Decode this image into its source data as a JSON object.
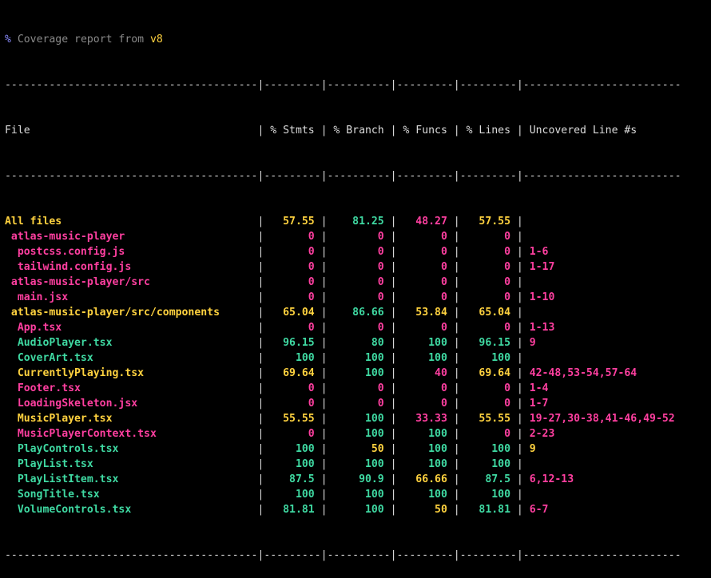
{
  "header": {
    "percent": "%",
    "text": "Coverage report from",
    "version": "v8"
  },
  "colors": {
    "high": "#3fd9a2",
    "medium": "#ffd23f",
    "low": "#ff3fa0",
    "neutral": "#dcdcdc"
  },
  "table": {
    "separator": "----------------------------------------|---------|----------|---------|---------|-------------------------",
    "columns": [
      "File",
      "% Stmts",
      "% Branch",
      "% Funcs",
      "% Lines",
      "Uncovered Line #s"
    ],
    "rows": [
      {
        "file": "All files",
        "indent": 0,
        "stmts": "57.55",
        "branch": "81.25",
        "funcs": "48.27",
        "lines": "57.55",
        "uncovered": "",
        "c": {
          "file": "medium",
          "stmts": "medium",
          "branch": "high",
          "funcs": "low",
          "lines": "medium",
          "uncovered": "low"
        }
      },
      {
        "file": "atlas-music-player",
        "indent": 1,
        "stmts": "0",
        "branch": "0",
        "funcs": "0",
        "lines": "0",
        "uncovered": "",
        "c": {
          "file": "low",
          "stmts": "low",
          "branch": "low",
          "funcs": "low",
          "lines": "low",
          "uncovered": "low"
        }
      },
      {
        "file": "postcss.config.js",
        "indent": 2,
        "stmts": "0",
        "branch": "0",
        "funcs": "0",
        "lines": "0",
        "uncovered": "1-6",
        "c": {
          "file": "low",
          "stmts": "low",
          "branch": "low",
          "funcs": "low",
          "lines": "low",
          "uncovered": "low"
        }
      },
      {
        "file": "tailwind.config.js",
        "indent": 2,
        "stmts": "0",
        "branch": "0",
        "funcs": "0",
        "lines": "0",
        "uncovered": "1-17",
        "c": {
          "file": "low",
          "stmts": "low",
          "branch": "low",
          "funcs": "low",
          "lines": "low",
          "uncovered": "low"
        }
      },
      {
        "file": "atlas-music-player/src",
        "indent": 1,
        "stmts": "0",
        "branch": "0",
        "funcs": "0",
        "lines": "0",
        "uncovered": "",
        "c": {
          "file": "low",
          "stmts": "low",
          "branch": "low",
          "funcs": "low",
          "lines": "low",
          "uncovered": "low"
        }
      },
      {
        "file": "main.jsx",
        "indent": 2,
        "stmts": "0",
        "branch": "0",
        "funcs": "0",
        "lines": "0",
        "uncovered": "1-10",
        "c": {
          "file": "low",
          "stmts": "low",
          "branch": "low",
          "funcs": "low",
          "lines": "low",
          "uncovered": "low"
        }
      },
      {
        "file": "atlas-music-player/src/components",
        "indent": 1,
        "stmts": "65.04",
        "branch": "86.66",
        "funcs": "53.84",
        "lines": "65.04",
        "uncovered": "",
        "c": {
          "file": "medium",
          "stmts": "medium",
          "branch": "high",
          "funcs": "medium",
          "lines": "medium",
          "uncovered": "low"
        }
      },
      {
        "file": "App.tsx",
        "indent": 2,
        "stmts": "0",
        "branch": "0",
        "funcs": "0",
        "lines": "0",
        "uncovered": "1-13",
        "c": {
          "file": "low",
          "stmts": "low",
          "branch": "low",
          "funcs": "low",
          "lines": "low",
          "uncovered": "low"
        }
      },
      {
        "file": "AudioPlayer.tsx",
        "indent": 2,
        "stmts": "96.15",
        "branch": "80",
        "funcs": "100",
        "lines": "96.15",
        "uncovered": "9",
        "c": {
          "file": "high",
          "stmts": "high",
          "branch": "high",
          "funcs": "high",
          "lines": "high",
          "uncovered": "low"
        }
      },
      {
        "file": "CoverArt.tsx",
        "indent": 2,
        "stmts": "100",
        "branch": "100",
        "funcs": "100",
        "lines": "100",
        "uncovered": "",
        "c": {
          "file": "high",
          "stmts": "high",
          "branch": "high",
          "funcs": "high",
          "lines": "high",
          "uncovered": "low"
        }
      },
      {
        "file": "CurrentlyPlaying.tsx",
        "indent": 2,
        "stmts": "69.64",
        "branch": "100",
        "funcs": "40",
        "lines": "69.64",
        "uncovered": "42-48,53-54,57-64",
        "c": {
          "file": "medium",
          "stmts": "medium",
          "branch": "high",
          "funcs": "low",
          "lines": "medium",
          "uncovered": "low"
        }
      },
      {
        "file": "Footer.tsx",
        "indent": 2,
        "stmts": "0",
        "branch": "0",
        "funcs": "0",
        "lines": "0",
        "uncovered": "1-4",
        "c": {
          "file": "low",
          "stmts": "low",
          "branch": "low",
          "funcs": "low",
          "lines": "low",
          "uncovered": "low"
        }
      },
      {
        "file": "LoadingSkeleton.jsx",
        "indent": 2,
        "stmts": "0",
        "branch": "0",
        "funcs": "0",
        "lines": "0",
        "uncovered": "1-7",
        "c": {
          "file": "low",
          "stmts": "low",
          "branch": "low",
          "funcs": "low",
          "lines": "low",
          "uncovered": "low"
        }
      },
      {
        "file": "MusicPlayer.tsx",
        "indent": 2,
        "stmts": "55.55",
        "branch": "100",
        "funcs": "33.33",
        "lines": "55.55",
        "uncovered": "19-27,30-38,41-46,49-52",
        "c": {
          "file": "medium",
          "stmts": "medium",
          "branch": "high",
          "funcs": "low",
          "lines": "medium",
          "uncovered": "low"
        }
      },
      {
        "file": "MusicPlayerContext.tsx",
        "indent": 2,
        "stmts": "0",
        "branch": "100",
        "funcs": "100",
        "lines": "0",
        "uncovered": "2-23",
        "c": {
          "file": "low",
          "stmts": "low",
          "branch": "high",
          "funcs": "high",
          "lines": "low",
          "uncovered": "low"
        }
      },
      {
        "file": "PlayControls.tsx",
        "indent": 2,
        "stmts": "100",
        "branch": "50",
        "funcs": "100",
        "lines": "100",
        "uncovered": "9",
        "c": {
          "file": "high",
          "stmts": "high",
          "branch": "medium",
          "funcs": "high",
          "lines": "high",
          "uncovered": "medium"
        }
      },
      {
        "file": "PlayList.tsx",
        "indent": 2,
        "stmts": "100",
        "branch": "100",
        "funcs": "100",
        "lines": "100",
        "uncovered": "",
        "c": {
          "file": "high",
          "stmts": "high",
          "branch": "high",
          "funcs": "high",
          "lines": "high",
          "uncovered": "low"
        }
      },
      {
        "file": "PlayListItem.tsx",
        "indent": 2,
        "stmts": "87.5",
        "branch": "90.9",
        "funcs": "66.66",
        "lines": "87.5",
        "uncovered": "6,12-13",
        "c": {
          "file": "high",
          "stmts": "high",
          "branch": "high",
          "funcs": "medium",
          "lines": "high",
          "uncovered": "low"
        }
      },
      {
        "file": "SongTitle.tsx",
        "indent": 2,
        "stmts": "100",
        "branch": "100",
        "funcs": "100",
        "lines": "100",
        "uncovered": "",
        "c": {
          "file": "high",
          "stmts": "high",
          "branch": "high",
          "funcs": "high",
          "lines": "high",
          "uncovered": "low"
        }
      },
      {
        "file": "VolumeControls.tsx",
        "indent": 2,
        "stmts": "81.81",
        "branch": "100",
        "funcs": "50",
        "lines": "81.81",
        "uncovered": "6-7",
        "c": {
          "file": "high",
          "stmts": "high",
          "branch": "high",
          "funcs": "medium",
          "lines": "high",
          "uncovered": "low"
        }
      }
    ]
  }
}
